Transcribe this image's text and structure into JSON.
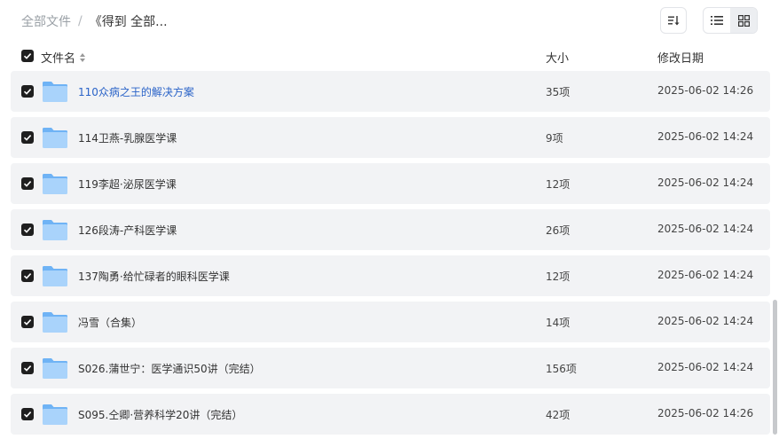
{
  "breadcrumb": {
    "root": "全部文件",
    "separator": "/",
    "current": "《得到 全部..."
  },
  "toolbar": {
    "sort_icon": "sort-icon",
    "list_icon": "list-view-icon",
    "grid_icon": "grid-view-icon",
    "active_view": "list"
  },
  "table": {
    "headers": {
      "name": "文件名",
      "size": "大小",
      "modified": "修改日期"
    },
    "rows": [
      {
        "name": "110众病之王的解决方案",
        "size": "35项",
        "modified": "2025-06-02 14:26",
        "highlighted": true
      },
      {
        "name": "114卫燕-乳腺医学课",
        "size": "9项",
        "modified": "2025-06-02 14:24"
      },
      {
        "name": "119李超·泌尿医学课",
        "size": "12项",
        "modified": "2025-06-02 14:24"
      },
      {
        "name": "126段涛-产科医学课",
        "size": "26项",
        "modified": "2025-06-02 14:24"
      },
      {
        "name": "137陶勇·给忙碌者的眼科医学课",
        "size": "12项",
        "modified": "2025-06-02 14:24"
      },
      {
        "name": "冯雪（合集）",
        "size": "14项",
        "modified": "2025-06-02 14:24"
      },
      {
        "name": "S026.蒲世宁：医学通识50讲（完结）",
        "size": "156项",
        "modified": "2025-06-02 14:24"
      },
      {
        "name": "S095.仝卿·营养科学20讲（完结）",
        "size": "42项",
        "modified": "2025-06-02 14:26"
      }
    ]
  },
  "colors": {
    "row_background": "#f2f3f5",
    "link_text": "#2a63c8",
    "checkbox": "#1f1f1f",
    "folder_light": "#a9d3fb",
    "folder_dark": "#6fb3f5"
  }
}
